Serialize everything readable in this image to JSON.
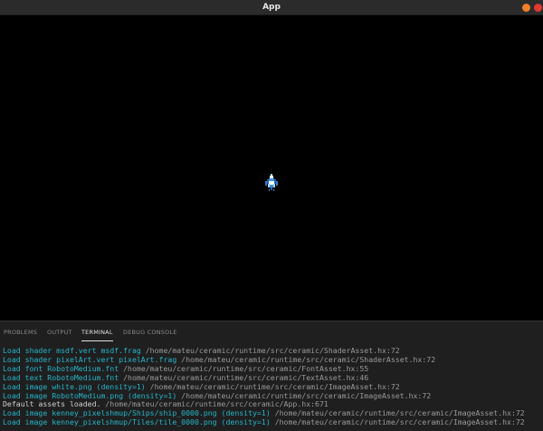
{
  "window": {
    "title": "App"
  },
  "panel": {
    "tabs": [
      "PROBLEMS",
      "OUTPUT",
      "TERMINAL",
      "DEBUG CONSOLE"
    ],
    "active_tab": "TERMINAL"
  },
  "terminal": {
    "lines": [
      {
        "msg": "Load shader msdf.vert msdf.frag",
        "path": " /home/mateu/ceramic/runtime/src/ceramic/ShaderAsset.hx:72"
      },
      {
        "msg": "Load shader pixelArt.vert pixelArt.frag",
        "path": " /home/mateu/ceramic/runtime/src/ceramic/ShaderAsset.hx:72"
      },
      {
        "msg": "Load font RobotoMedium.fnt",
        "path": " /home/mateu/ceramic/runtime/src/ceramic/FontAsset.hx:55"
      },
      {
        "msg": "Load text RobotoMedium.fnt",
        "path": " /home/mateu/ceramic/runtime/src/ceramic/TextAsset.hx:46"
      },
      {
        "msg": "Load image white.png (density=1)",
        "path": " /home/mateu/ceramic/runtime/src/ceramic/ImageAsset.hx:72"
      },
      {
        "msg": "Load image RobotoMedium.png (density=1)",
        "path": " /home/mateu/ceramic/runtime/src/ceramic/ImageAsset.hx:72"
      },
      {
        "msg": "Default assets loaded.",
        "path": " /home/mateu/ceramic/runtime/src/ceramic/App.hx:671"
      },
      {
        "msg": "Load image kenney_pixelshmup/Ships/ship_0000.png (density=1)",
        "path": " /home/mateu/ceramic/runtime/src/ceramic/ImageAsset.hx:72"
      },
      {
        "msg": "Load image kenney_pixelshmup/Tiles/tile_0000.png (density=1)",
        "path": " /home/mateu/ceramic/runtime/src/ceramic/ImageAsset.hx:72"
      }
    ]
  },
  "colors": {
    "log_message": "#27b5c9",
    "log_path": "#9a9a9a",
    "plain_message": "#cfcfcf",
    "close_button": "#e3382f",
    "minimize_button": "#ef7f2a"
  },
  "icons": {
    "minimize": "minimize-icon",
    "close": "close-icon",
    "ship": "ship-sprite"
  }
}
